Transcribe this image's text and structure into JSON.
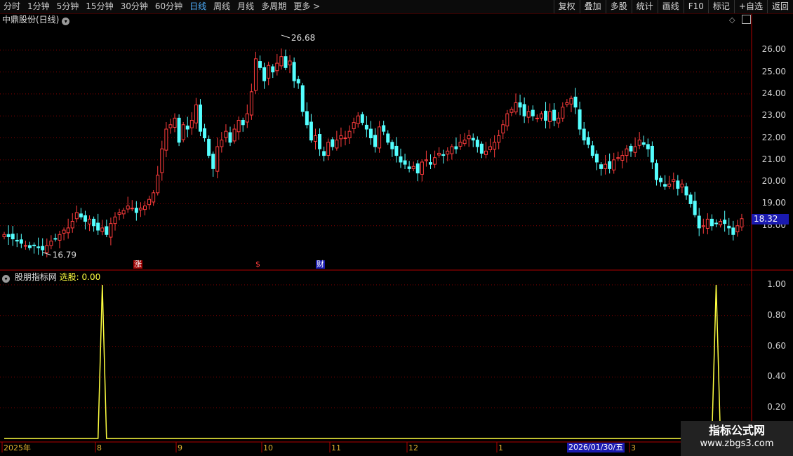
{
  "toolbar": {
    "left_items": [
      "分时",
      "1分钟",
      "5分钟",
      "15分钟",
      "30分钟",
      "60分钟",
      "日线",
      "周线",
      "月线",
      "多周期",
      "更多 >"
    ],
    "active_index": 6,
    "right_items": [
      "复权",
      "叠加",
      "多股",
      "统计",
      "画线",
      "F10",
      "标记",
      "+自选",
      "返回"
    ]
  },
  "main_panel": {
    "title": "中鼎股份(日线)",
    "price_label": "18.32",
    "high_label": "26.68",
    "low_label": "16.79",
    "markers": [
      "涨",
      "$",
      "财"
    ]
  },
  "sub_panel": {
    "indicator": "股朋指标网",
    "series_label": "选股: 0.00"
  },
  "price_ticks": [
    "26.00",
    "25.00",
    "24.00",
    "23.00",
    "22.00",
    "21.00",
    "20.00",
    "19.00",
    "18.00"
  ],
  "ind_ticks": [
    "1.00",
    "0.80",
    "0.60",
    "0.40",
    "0.20"
  ],
  "x_labels": [
    "2025年",
    "8",
    "9",
    "10",
    "11",
    "12",
    "1",
    "3"
  ],
  "date_badge": "2026/01/30/五",
  "watermark": {
    "line1": "指标公式网",
    "line2": "www.zbgs3.com"
  },
  "colors": {
    "up": "#ff3c3c",
    "down": "#54ffff",
    "signal": "#ffff40",
    "grid": "#8a0000"
  },
  "chart_data": [
    {
      "type": "candlestick",
      "title": "中鼎股份(日线)",
      "ylim": [
        16.3,
        27.0
      ],
      "highlighted_values": {
        "high": 26.68,
        "low": 16.79,
        "last": 18.32
      },
      "closes": [
        17.6,
        17.5,
        17.4,
        17.3,
        17.2,
        17.1,
        17.0,
        17.1,
        17.0,
        16.9,
        17.1,
        17.3,
        17.4,
        17.6,
        17.8,
        17.9,
        18.2,
        18.6,
        18.4,
        18.2,
        18.3,
        18.0,
        17.8,
        17.9,
        17.6,
        18.1,
        18.4,
        18.6,
        18.7,
        18.9,
        18.8,
        18.6,
        18.8,
        18.9,
        19.2,
        19.5,
        20.3,
        21.5,
        22.4,
        22.6,
        22.9,
        21.8,
        22.6,
        22.4,
        22.8,
        23.5,
        22.3,
        22.0,
        21.2,
        20.6,
        21.6,
        21.9,
        22.3,
        21.8,
        22.4,
        22.8,
        22.6,
        23.1,
        24.1,
        25.6,
        25.2,
        24.6,
        25.3,
        25.0,
        25.4,
        25.7,
        25.2,
        25.5,
        24.6,
        24.5,
        23.2,
        22.6,
        21.9,
        22.1,
        21.5,
        21.2,
        21.8,
        21.6,
        21.9,
        22.1,
        22.0,
        22.3,
        22.7,
        23.0,
        22.7,
        22.4,
        22.0,
        21.6,
        22.5,
        22.3,
        21.8,
        21.5,
        21.2,
        20.9,
        20.8,
        20.6,
        20.7,
        20.4,
        20.9,
        21.0,
        20.8,
        21.1,
        21.3,
        21.2,
        21.4,
        21.6,
        21.5,
        21.8,
        21.9,
        22.1,
        21.9,
        21.6,
        21.3,
        21.4,
        21.6,
        21.8,
        22.1,
        22.6,
        23.1,
        23.3,
        23.6,
        23.4,
        23.0,
        23.2,
        23.0,
        22.9,
        23.1,
        22.8,
        23.2,
        22.8,
        22.9,
        23.4,
        23.6,
        23.8,
        23.4,
        22.4,
        21.9,
        21.7,
        21.2,
        20.9,
        20.6,
        20.8,
        20.6,
        21.0,
        21.1,
        21.2,
        21.5,
        21.4,
        21.6,
        21.9,
        21.7,
        21.5,
        20.9,
        20.1,
        20.0,
        19.8,
        19.9,
        20.1,
        19.7,
        19.9,
        19.4,
        19.0,
        18.5,
        17.9,
        18.0,
        18.3,
        18.0,
        18.1,
        18.2,
        18.1,
        17.9,
        17.6,
        18.0,
        18.32
      ]
    },
    {
      "type": "line",
      "name": "选股",
      "ylim": [
        0,
        1.0
      ],
      "signal_indices": [
        23,
        167
      ],
      "baseline": 0.0,
      "peak": 1.0
    }
  ]
}
